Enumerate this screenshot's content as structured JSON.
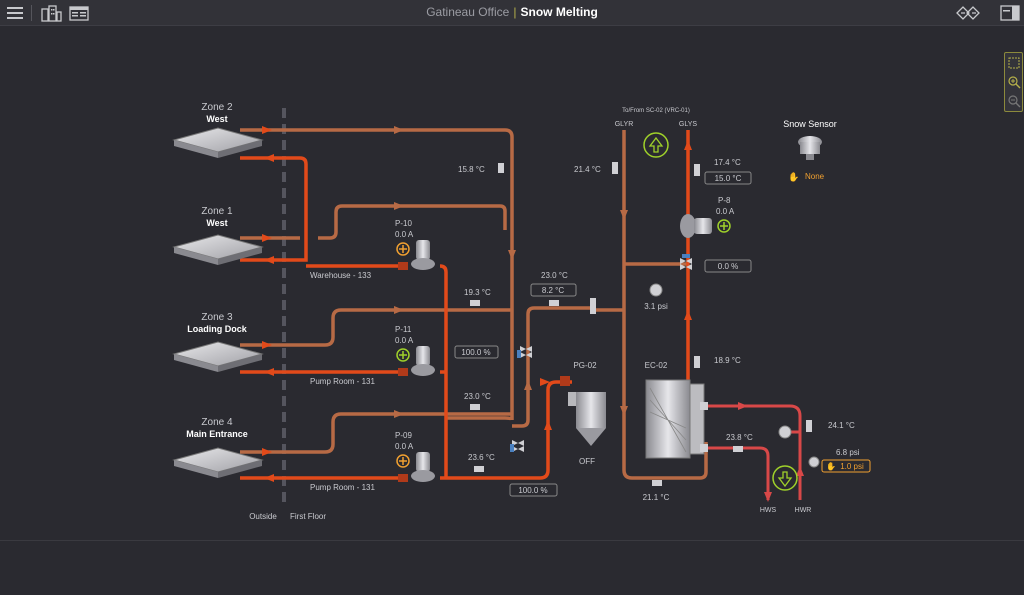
{
  "header": {
    "location": "Gatineau Office",
    "page_name": "Snow Melting"
  },
  "icons": {
    "menu": "hamburger-menu-icon",
    "buildings": "buildings-icon",
    "dashboard": "dashboard-icon",
    "navigate": "navigate-arrows-icon",
    "panel": "side-panel-icon",
    "select": "select-area-icon",
    "zoom_in": "zoom-in-icon",
    "zoom_out": "zoom-out-icon"
  },
  "colors": {
    "supply": "#e24a1a",
    "return": "#b76a45",
    "glycol_r": "#e04848",
    "accent": "#b5b04a",
    "pump_run": "#f0a030",
    "ok_green": "#9fd12a"
  },
  "zones": [
    {
      "name": "Zone 2",
      "sub": "West"
    },
    {
      "name": "Zone 1",
      "sub": "West"
    },
    {
      "name": "Zone 3",
      "sub": "Loading Dock"
    },
    {
      "name": "Zone 4",
      "sub": "Main Entrance"
    }
  ],
  "boundary": {
    "outside": "Outside",
    "first_floor": "First Floor"
  },
  "pumps": [
    {
      "name": "P-10",
      "amps": "0.0 A",
      "location": "Warehouse - 133"
    },
    {
      "name": "P-11",
      "amps": "0.0 A",
      "location": "Pump Room - 131"
    },
    {
      "name": "P-09",
      "amps": "0.0 A",
      "location": "Pump Room - 131"
    },
    {
      "name": "P-8",
      "amps": "0.0 A"
    }
  ],
  "temps": {
    "zone2_return": "15.8 °C",
    "mix_upper": "19.3 °C",
    "mix_mid": "23.0 °C",
    "mix_low": "23.6 °C",
    "header_top": "23.0 °C",
    "header_sp": "8.2 °C",
    "glyr": "21.4 °C",
    "glys": "17.4 °C",
    "glys_sp": "15.0 °C",
    "ec_in": "18.9 °C",
    "ec_out": "23.8 °C",
    "ec_bottom": "21.1 °C",
    "hwr": "24.1 °C"
  },
  "valves": {
    "v1": "100.0 %",
    "v2": "100.0 %",
    "v3": "0.0 %"
  },
  "pressure": {
    "glycol": "3.1 psi",
    "hw": "6.8 psi",
    "hw_sp": "1.0 psi"
  },
  "equipment": {
    "tank": "PG-02",
    "tank_status": "OFF",
    "exchanger": "EC-02",
    "connection": "To/From SC-02 (VRC-01)",
    "glyr": "GLYR",
    "glys": "GLYS",
    "hws": "HWS",
    "hwr": "HWR"
  },
  "snow_sensor": {
    "title": "Snow Sensor",
    "status": "None"
  }
}
